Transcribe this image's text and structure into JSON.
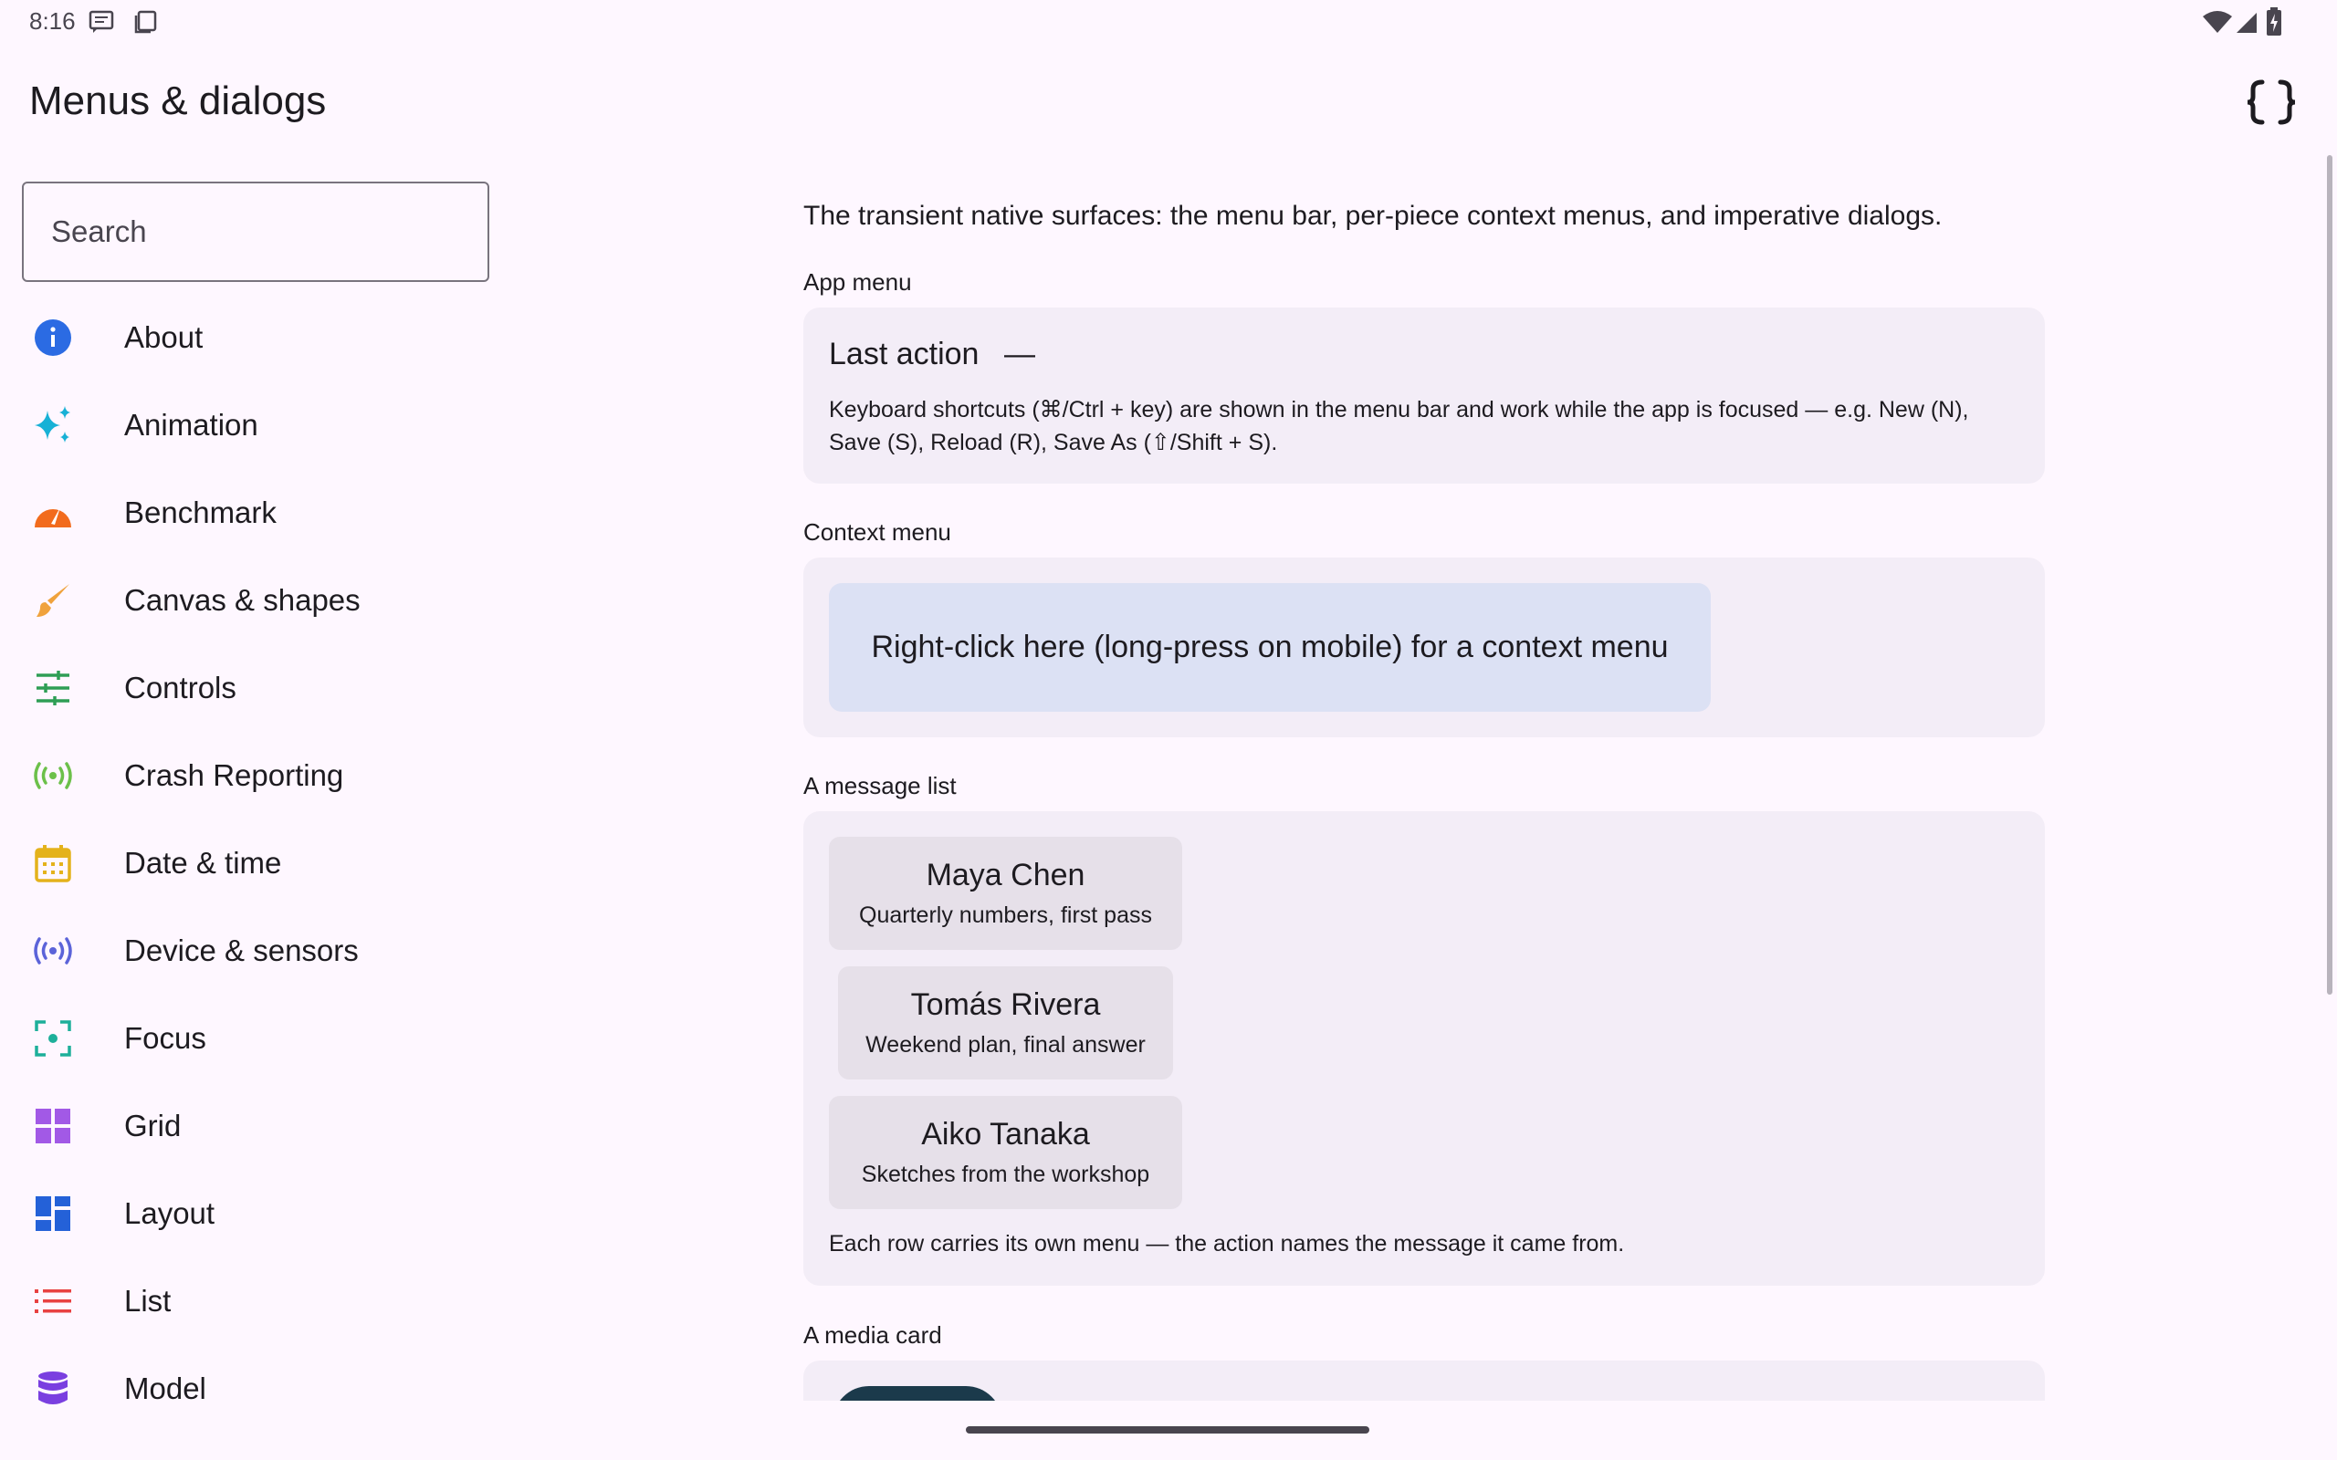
{
  "status_bar": {
    "time": "8:16"
  },
  "header": {
    "title": "Menus & dialogs",
    "code_icon": "code-braces-icon"
  },
  "search": {
    "placeholder": "Search",
    "value": ""
  },
  "sidebar": {
    "items": [
      {
        "label": "About",
        "icon": "info-icon",
        "color": "#2B6BE3"
      },
      {
        "label": "Animation",
        "icon": "sparkle-icon",
        "color": "#17B1D6"
      },
      {
        "label": "Benchmark",
        "icon": "speedometer-icon",
        "color": "#F26B1D"
      },
      {
        "label": "Canvas & shapes",
        "icon": "brush-icon",
        "color": "#F0A23C"
      },
      {
        "label": "Controls",
        "icon": "sliders-icon",
        "color": "#2E9E55"
      },
      {
        "label": "Crash Reporting",
        "icon": "broadcast-icon",
        "color": "#6CC04A"
      },
      {
        "label": "Date & time",
        "icon": "calendar-icon",
        "color": "#E4B21B"
      },
      {
        "label": "Device & sensors",
        "icon": "sensors-icon",
        "color": "#5B63D9"
      },
      {
        "label": "Focus",
        "icon": "focus-icon",
        "color": "#1DAF9A"
      },
      {
        "label": "Grid",
        "icon": "grid-icon",
        "color": "#A259E6"
      },
      {
        "label": "Layout",
        "icon": "layout-icon",
        "color": "#2461D8"
      },
      {
        "label": "List",
        "icon": "list-icon",
        "color": "#E84141"
      },
      {
        "label": "Model",
        "icon": "database-icon",
        "color": "#7A3FE0"
      }
    ]
  },
  "main": {
    "intro": "The transient native surfaces: the menu bar, per-piece context menus, and imperative dialogs.",
    "app_menu": {
      "label": "App menu",
      "last_action_title": "Last action",
      "last_action_value": "—",
      "shortcut_line1": "Keyboard shortcuts (⌘/Ctrl + key) are shown in the menu bar and work while the app is focused — e.g. New (N),",
      "shortcut_line2": "Save (S), Reload (R), Save As (⇧/Shift + S)."
    },
    "context_menu": {
      "label": "Context menu",
      "target_text": "Right-click here (long-press on mobile) for a context menu"
    },
    "message_list": {
      "label": "A message list",
      "messages": [
        {
          "name": "Maya Chen",
          "subject": "Quarterly numbers, first pass"
        },
        {
          "name": "Tomás Rivera",
          "subject": "Weekend plan, final answer"
        },
        {
          "name": "Aiko Tanaka",
          "subject": "Sketches from the workshop"
        }
      ],
      "note": "Each row carries its own menu — the action names the message it came from."
    },
    "media_card": {
      "label": "A media card"
    }
  },
  "colors": {
    "background": "#FEF7FF",
    "card": "#F3EDF7",
    "context_target": "#DCE1F4",
    "message_chip": "#E6E0E9"
  }
}
